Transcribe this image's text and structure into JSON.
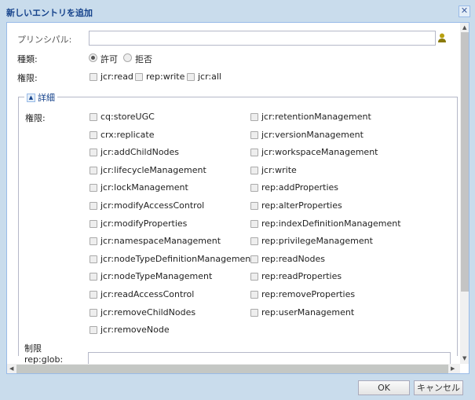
{
  "dialog": {
    "title": "新しいエントリを追加",
    "close_icon": "close-icon"
  },
  "principal": {
    "label": "プリンシパル:",
    "value": "",
    "icon": "user-icon"
  },
  "type": {
    "label": "種類:",
    "options": [
      {
        "label": "許可",
        "selected": true
      },
      {
        "label": "拒否",
        "selected": false
      }
    ]
  },
  "privileges": {
    "label": "権限:",
    "options": [
      "jcr:read",
      "rep:write",
      "jcr:all"
    ]
  },
  "details": {
    "legend": "詳細",
    "label": "権限:",
    "left": [
      "cq:storeUGC",
      "crx:replicate",
      "jcr:addChildNodes",
      "jcr:lifecycleManagement",
      "jcr:lockManagement",
      "jcr:modifyAccessControl",
      "jcr:modifyProperties",
      "jcr:namespaceManagement",
      "jcr:nodeTypeDefinitionManagement",
      "jcr:nodeTypeManagement",
      "jcr:readAccessControl",
      "jcr:removeChildNodes",
      "jcr:removeNode"
    ],
    "right": [
      "jcr:retentionManagement",
      "jcr:versionManagement",
      "jcr:workspaceManagement",
      "jcr:write",
      "rep:addProperties",
      "rep:alterProperties",
      "rep:indexDefinitionManagement",
      "rep:privilegeManagement",
      "rep:readNodes",
      "rep:readProperties",
      "rep:removeProperties",
      "rep:userManagement"
    ]
  },
  "restrictions": {
    "label": "制限",
    "glob_label": "rep:glob:",
    "glob_value": ""
  },
  "footer": {
    "ok": "OK",
    "cancel": "キャンセル"
  }
}
